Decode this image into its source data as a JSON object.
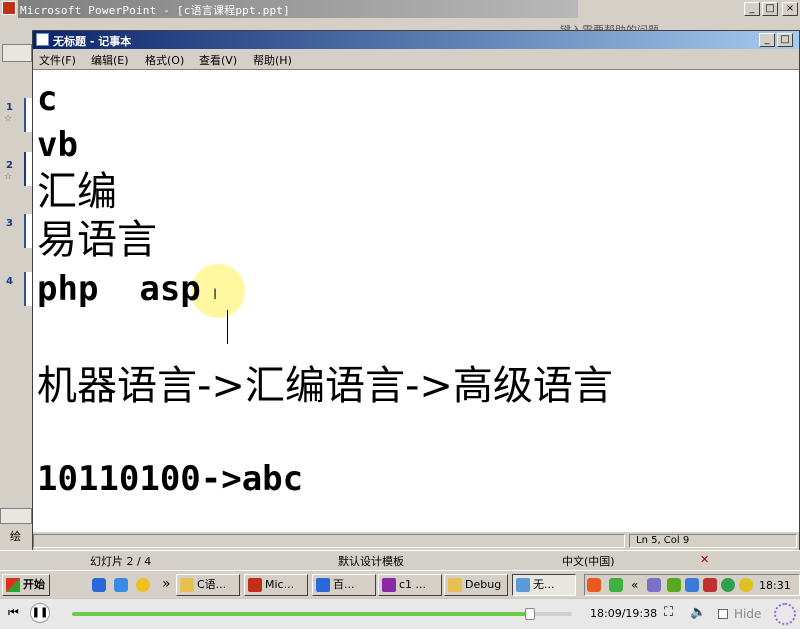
{
  "ppt": {
    "title": "Microsoft PowerPoint - [c语言课程ppt.ppt]",
    "menu_hint": "键入需要帮助的问题",
    "controls": {
      "min": "_",
      "max": "□",
      "close": "×"
    },
    "slides": [
      {
        "num": "1",
        "star": "☆"
      },
      {
        "num": "2",
        "star": "☆"
      },
      {
        "num": "3",
        "star": ""
      },
      {
        "num": "4",
        "star": ""
      }
    ],
    "draw_label": "绘",
    "status": {
      "slide": "幻灯片 2 / 4",
      "template": "默认设计模板",
      "lang": "中文(中国)"
    }
  },
  "notepad": {
    "title": "无标题 - 记事本",
    "menu": [
      "文件(F)",
      "编辑(E)",
      "格式(O)",
      "查看(V)",
      "帮助(H)"
    ],
    "lines": [
      "c",
      "vb",
      "汇编",
      "易语言",
      "php  asp",
      "",
      "机器语言->汇编语言->高级语言",
      "",
      "10110100->abc"
    ],
    "status": "Ln 5, Col 9"
  },
  "taskbar": {
    "start": "开始",
    "overflow": "»",
    "buttons": [
      {
        "label": "C语...",
        "icon": "folder-icon",
        "color": "#e8c050"
      },
      {
        "label": "Mic...",
        "icon": "powerpoint-icon",
        "color": "#c0301a"
      },
      {
        "label": "百...",
        "icon": "browser-icon",
        "color": "#2a6ad8"
      },
      {
        "label": "c1 ...",
        "icon": "vc-icon",
        "color": "#8a2aa8"
      },
      {
        "label": "Debug",
        "icon": "folder-icon",
        "color": "#e8c050"
      },
      {
        "label": "无...",
        "icon": "notepad-icon",
        "color": "#5a9ad8"
      }
    ],
    "tray_chevron": "«",
    "clock": "18:31"
  },
  "player": {
    "time": "18:09/19:38",
    "hide_label": "Hide",
    "progress": 0.915
  }
}
